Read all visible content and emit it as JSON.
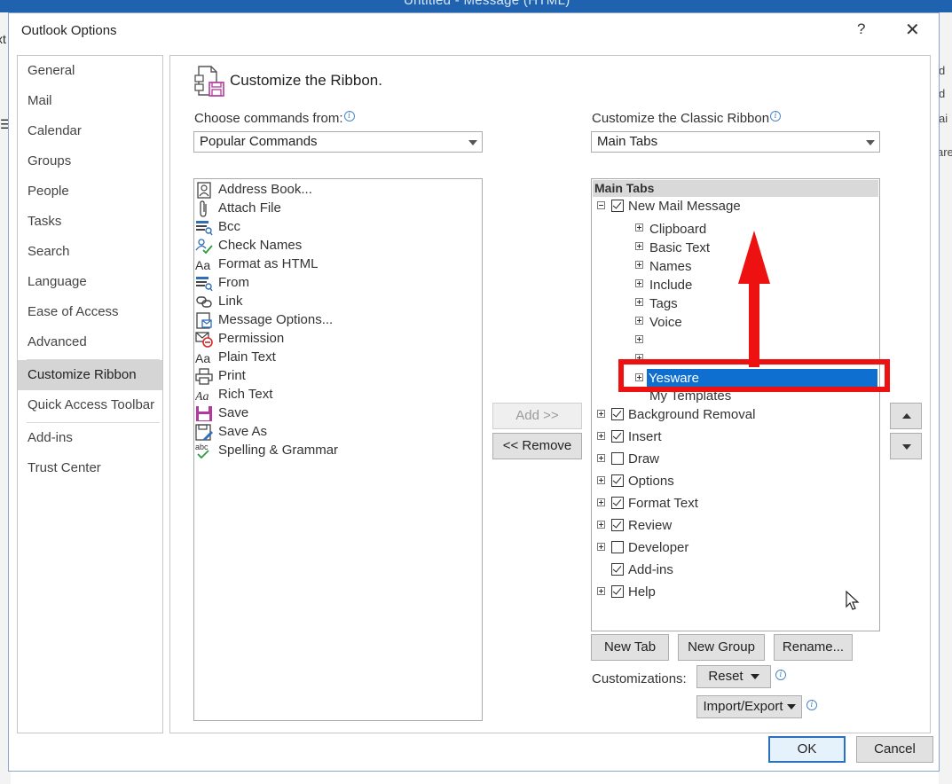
{
  "background_window": {
    "title": "Untitled  -  Message (HTML)",
    "left_fragments": [
      "xt",
      "☰"
    ],
    "right_fragments": [
      "d",
      "d",
      "ai",
      "are"
    ]
  },
  "dialog": {
    "title": "Outlook Options",
    "help_label": "?",
    "close_label": "✕"
  },
  "nav": {
    "items": [
      {
        "label": "General"
      },
      {
        "label": "Mail"
      },
      {
        "label": "Calendar"
      },
      {
        "label": "Groups"
      },
      {
        "label": "People"
      },
      {
        "label": "Tasks"
      },
      {
        "label": "Search"
      },
      {
        "label": "Language"
      },
      {
        "label": "Ease of Access"
      },
      {
        "label": "Advanced"
      },
      {
        "label": "Customize Ribbon",
        "active": true
      },
      {
        "label": "Quick Access Toolbar"
      },
      {
        "label": "Add-ins"
      },
      {
        "label": "Trust Center"
      }
    ]
  },
  "header": {
    "title": "Customize the Ribbon.",
    "icon": "customize-ribbon-icon"
  },
  "left_panel": {
    "label": "Choose commands from:",
    "combo_value": "Popular Commands",
    "commands": [
      {
        "label": "Address Book...",
        "icon": "address-book-icon"
      },
      {
        "label": "Attach File",
        "icon": "paperclip-icon"
      },
      {
        "label": "Bcc",
        "icon": "bcc-icon"
      },
      {
        "label": "Check Names",
        "icon": "check-names-icon"
      },
      {
        "label": "Format as HTML",
        "icon": "format-html-icon"
      },
      {
        "label": "From",
        "icon": "from-icon"
      },
      {
        "label": "Link",
        "icon": "link-icon"
      },
      {
        "label": "Message Options...",
        "icon": "message-options-icon"
      },
      {
        "label": "Permission",
        "icon": "permission-icon"
      },
      {
        "label": "Plain Text",
        "icon": "plain-text-icon"
      },
      {
        "label": "Print",
        "icon": "print-icon"
      },
      {
        "label": "Rich Text",
        "icon": "rich-text-icon"
      },
      {
        "label": "Save",
        "icon": "save-icon"
      },
      {
        "label": "Save As",
        "icon": "save-as-icon"
      },
      {
        "label": "Spelling & Grammar",
        "icon": "spelling-icon"
      }
    ]
  },
  "middle_buttons": {
    "add": "Add >>",
    "remove": "<< Remove"
  },
  "right_panel": {
    "label": "Customize the Classic Ribbon",
    "combo_value": "Main Tabs",
    "tree_header": "Main Tabs",
    "root_tab": "New Mail Message",
    "groups": [
      "Clipboard",
      "Basic Text",
      "Names",
      "Include",
      "Tags",
      "Voice",
      "",
      "",
      "Yesware",
      "My Templates"
    ],
    "selected_group": "Yesware",
    "tabs": [
      {
        "label": "Background Removal",
        "checked": true,
        "expandable": true
      },
      {
        "label": "Insert",
        "checked": true,
        "expandable": true
      },
      {
        "label": "Draw",
        "checked": false,
        "expandable": true
      },
      {
        "label": "Options",
        "checked": true,
        "expandable": true
      },
      {
        "label": "Format Text",
        "checked": true,
        "expandable": true
      },
      {
        "label": "Review",
        "checked": true,
        "expandable": true
      },
      {
        "label": "Developer",
        "checked": false,
        "expandable": true
      },
      {
        "label": "Add-ins",
        "checked": true,
        "expandable": false
      },
      {
        "label": "Help",
        "checked": true,
        "expandable": true
      }
    ]
  },
  "bottom_buttons": {
    "new_tab": "New Tab",
    "new_group": "New Group",
    "rename": "Rename...",
    "customizations_label": "Customizations:",
    "reset": "Reset",
    "import_export": "Import/Export"
  },
  "footer": {
    "ok": "OK",
    "cancel": "Cancel"
  },
  "annotation": {
    "color": "#ee1111"
  }
}
